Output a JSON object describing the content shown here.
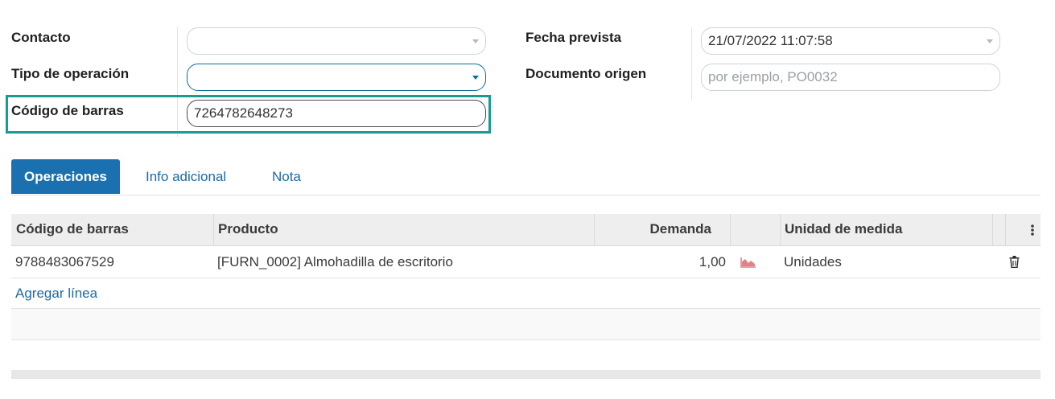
{
  "form": {
    "contact": {
      "label": "Contacto",
      "value": ""
    },
    "operation_type": {
      "label": "Tipo de operación",
      "value": ""
    },
    "barcode": {
      "label": "Código de barras",
      "value": "7264782648273"
    },
    "scheduled_date": {
      "label": "Fecha prevista",
      "value": "21/07/2022 11:07:58"
    },
    "source_document": {
      "label": "Documento origen",
      "value": "",
      "placeholder": "por ejemplo, PO0032"
    }
  },
  "tabs": [
    {
      "label": "Operaciones",
      "active": true
    },
    {
      "label": "Info adicional",
      "active": false
    },
    {
      "label": "Nota",
      "active": false
    }
  ],
  "table": {
    "columns": {
      "barcode": "Código de barras",
      "product": "Producto",
      "demand": "Demanda",
      "uom": "Unidad de medida"
    },
    "rows": [
      {
        "barcode": "9788483067529",
        "product": "[FURN_0002] Almohadilla de escritorio",
        "demand": "1,00",
        "uom": "Unidades"
      }
    ],
    "add_line_label": "Agregar línea"
  },
  "icons": {
    "forecast": "area-chart-icon",
    "delete": "trash-icon",
    "column_options": "vertical-ellipsis-icon",
    "dropdown": "chevron-down-icon"
  },
  "colors": {
    "accent": "#1b70b0",
    "highlight": "#169c95",
    "forecast_icon": "#e0828a"
  }
}
